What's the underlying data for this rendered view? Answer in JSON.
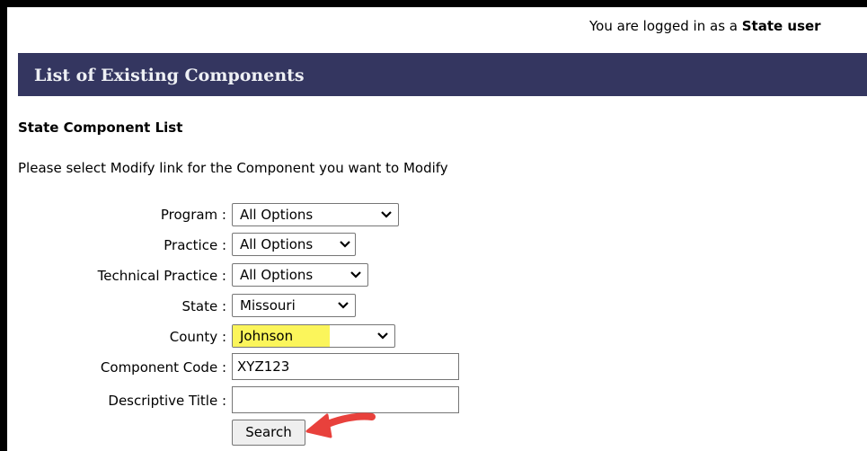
{
  "header": {
    "login_prefix": "You are logged in as a ",
    "login_role": "State user"
  },
  "banner": {
    "title": "List of Existing Components"
  },
  "section": {
    "title": "State Component List",
    "instruction": "Please select Modify link for the Component you want to Modify"
  },
  "form": {
    "program": {
      "label": "Program :",
      "value": "All Options"
    },
    "practice": {
      "label": "Practice :",
      "value": "All Options"
    },
    "technical_practice": {
      "label": "Technical Practice :",
      "value": "All Options"
    },
    "state": {
      "label": "State :",
      "value": "Missouri"
    },
    "county": {
      "label": "County :",
      "value": "Johnson"
    },
    "component_code": {
      "label": "Component Code :",
      "value": "XYZ123",
      "placeholder": ""
    },
    "descriptive_title": {
      "label": "Descriptive Title :",
      "value": "",
      "placeholder": ""
    },
    "search_label": "Search"
  },
  "colors": {
    "banner_bg": "#343660",
    "highlight": "#fbf55b",
    "annotation_arrow": "#e8413c"
  },
  "icons": {
    "dropdown": "chevron-down-icon",
    "annotation": "red-arrow-icon"
  }
}
